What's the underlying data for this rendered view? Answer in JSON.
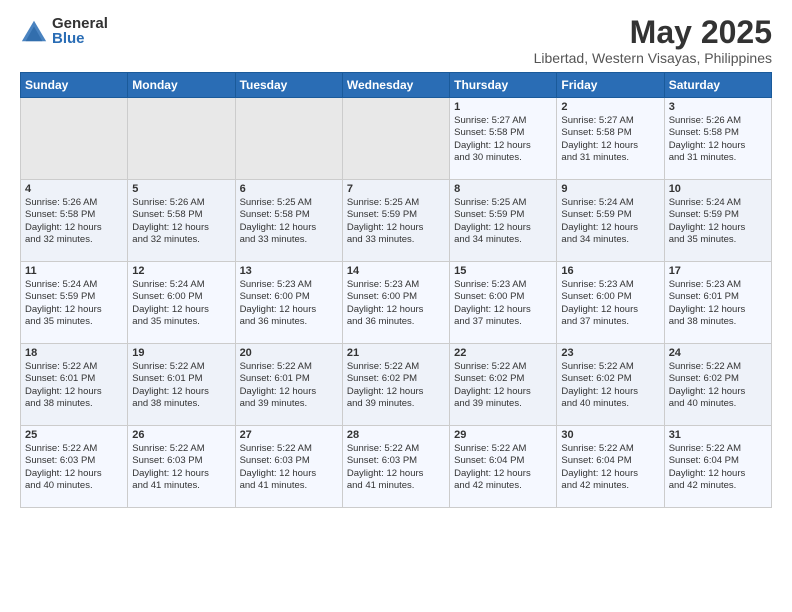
{
  "header": {
    "logo_general": "General",
    "logo_blue": "Blue",
    "title": "May 2025",
    "subtitle": "Libertad, Western Visayas, Philippines"
  },
  "weekdays": [
    "Sunday",
    "Monday",
    "Tuesday",
    "Wednesday",
    "Thursday",
    "Friday",
    "Saturday"
  ],
  "weeks": [
    [
      {
        "day": "",
        "info": ""
      },
      {
        "day": "",
        "info": ""
      },
      {
        "day": "",
        "info": ""
      },
      {
        "day": "",
        "info": ""
      },
      {
        "day": "1",
        "info": "Sunrise: 5:27 AM\nSunset: 5:58 PM\nDaylight: 12 hours\nand 30 minutes."
      },
      {
        "day": "2",
        "info": "Sunrise: 5:27 AM\nSunset: 5:58 PM\nDaylight: 12 hours\nand 31 minutes."
      },
      {
        "day": "3",
        "info": "Sunrise: 5:26 AM\nSunset: 5:58 PM\nDaylight: 12 hours\nand 31 minutes."
      }
    ],
    [
      {
        "day": "4",
        "info": "Sunrise: 5:26 AM\nSunset: 5:58 PM\nDaylight: 12 hours\nand 32 minutes."
      },
      {
        "day": "5",
        "info": "Sunrise: 5:26 AM\nSunset: 5:58 PM\nDaylight: 12 hours\nand 32 minutes."
      },
      {
        "day": "6",
        "info": "Sunrise: 5:25 AM\nSunset: 5:58 PM\nDaylight: 12 hours\nand 33 minutes."
      },
      {
        "day": "7",
        "info": "Sunrise: 5:25 AM\nSunset: 5:59 PM\nDaylight: 12 hours\nand 33 minutes."
      },
      {
        "day": "8",
        "info": "Sunrise: 5:25 AM\nSunset: 5:59 PM\nDaylight: 12 hours\nand 34 minutes."
      },
      {
        "day": "9",
        "info": "Sunrise: 5:24 AM\nSunset: 5:59 PM\nDaylight: 12 hours\nand 34 minutes."
      },
      {
        "day": "10",
        "info": "Sunrise: 5:24 AM\nSunset: 5:59 PM\nDaylight: 12 hours\nand 35 minutes."
      }
    ],
    [
      {
        "day": "11",
        "info": "Sunrise: 5:24 AM\nSunset: 5:59 PM\nDaylight: 12 hours\nand 35 minutes."
      },
      {
        "day": "12",
        "info": "Sunrise: 5:24 AM\nSunset: 6:00 PM\nDaylight: 12 hours\nand 35 minutes."
      },
      {
        "day": "13",
        "info": "Sunrise: 5:23 AM\nSunset: 6:00 PM\nDaylight: 12 hours\nand 36 minutes."
      },
      {
        "day": "14",
        "info": "Sunrise: 5:23 AM\nSunset: 6:00 PM\nDaylight: 12 hours\nand 36 minutes."
      },
      {
        "day": "15",
        "info": "Sunrise: 5:23 AM\nSunset: 6:00 PM\nDaylight: 12 hours\nand 37 minutes."
      },
      {
        "day": "16",
        "info": "Sunrise: 5:23 AM\nSunset: 6:00 PM\nDaylight: 12 hours\nand 37 minutes."
      },
      {
        "day": "17",
        "info": "Sunrise: 5:23 AM\nSunset: 6:01 PM\nDaylight: 12 hours\nand 38 minutes."
      }
    ],
    [
      {
        "day": "18",
        "info": "Sunrise: 5:22 AM\nSunset: 6:01 PM\nDaylight: 12 hours\nand 38 minutes."
      },
      {
        "day": "19",
        "info": "Sunrise: 5:22 AM\nSunset: 6:01 PM\nDaylight: 12 hours\nand 38 minutes."
      },
      {
        "day": "20",
        "info": "Sunrise: 5:22 AM\nSunset: 6:01 PM\nDaylight: 12 hours\nand 39 minutes."
      },
      {
        "day": "21",
        "info": "Sunrise: 5:22 AM\nSunset: 6:02 PM\nDaylight: 12 hours\nand 39 minutes."
      },
      {
        "day": "22",
        "info": "Sunrise: 5:22 AM\nSunset: 6:02 PM\nDaylight: 12 hours\nand 39 minutes."
      },
      {
        "day": "23",
        "info": "Sunrise: 5:22 AM\nSunset: 6:02 PM\nDaylight: 12 hours\nand 40 minutes."
      },
      {
        "day": "24",
        "info": "Sunrise: 5:22 AM\nSunset: 6:02 PM\nDaylight: 12 hours\nand 40 minutes."
      }
    ],
    [
      {
        "day": "25",
        "info": "Sunrise: 5:22 AM\nSunset: 6:03 PM\nDaylight: 12 hours\nand 40 minutes."
      },
      {
        "day": "26",
        "info": "Sunrise: 5:22 AM\nSunset: 6:03 PM\nDaylight: 12 hours\nand 41 minutes."
      },
      {
        "day": "27",
        "info": "Sunrise: 5:22 AM\nSunset: 6:03 PM\nDaylight: 12 hours\nand 41 minutes."
      },
      {
        "day": "28",
        "info": "Sunrise: 5:22 AM\nSunset: 6:03 PM\nDaylight: 12 hours\nand 41 minutes."
      },
      {
        "day": "29",
        "info": "Sunrise: 5:22 AM\nSunset: 6:04 PM\nDaylight: 12 hours\nand 42 minutes."
      },
      {
        "day": "30",
        "info": "Sunrise: 5:22 AM\nSunset: 6:04 PM\nDaylight: 12 hours\nand 42 minutes."
      },
      {
        "day": "31",
        "info": "Sunrise: 5:22 AM\nSunset: 6:04 PM\nDaylight: 12 hours\nand 42 minutes."
      }
    ]
  ]
}
